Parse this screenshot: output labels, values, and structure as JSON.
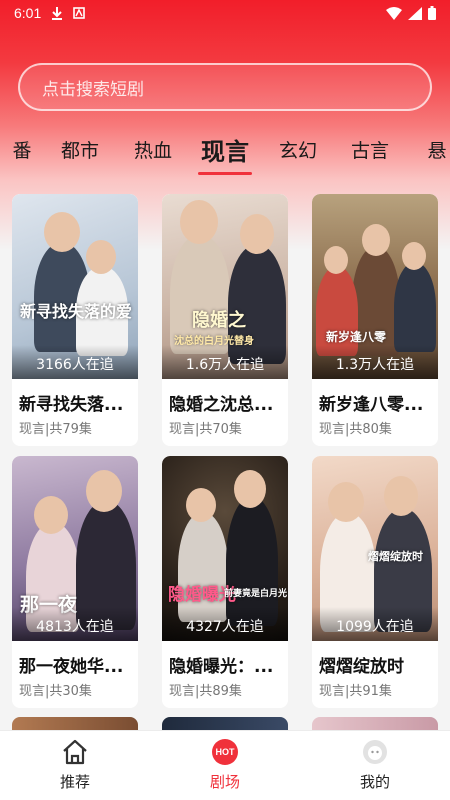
{
  "status_bar": {
    "time": "6:01"
  },
  "search": {
    "placeholder": "点击搜索短剧"
  },
  "tabs": [
    {
      "label": "番"
    },
    {
      "label": "都市"
    },
    {
      "label": "热血"
    },
    {
      "label": "现言"
    },
    {
      "label": "玄幻"
    },
    {
      "label": "古言"
    },
    {
      "label": "悬"
    }
  ],
  "active_tab": "现言",
  "dramas": [
    {
      "title": "新寻找失落...",
      "watchers": "3166人在追",
      "meta": "现言|共79集",
      "poster_text": "新寻找失落的爱"
    },
    {
      "title": "隐婚之沈总...",
      "watchers": "1.6万人在追",
      "meta": "现言|共70集",
      "poster_text": "隐婚之",
      "poster_sub": "沈总的白月光替身"
    },
    {
      "title": "新岁逢八零...",
      "watchers": "1.3万人在追",
      "meta": "现言|共80集",
      "poster_text": "新岁逢八零"
    },
    {
      "title": "那一夜她华...",
      "watchers": "4813人在追",
      "meta": "现言|共30集",
      "poster_text": "那一夜"
    },
    {
      "title": "隐婚曝光：...",
      "watchers": "4327人在追",
      "meta": "现言|共89集",
      "poster_text": "隐婚曝光",
      "poster_sub": "前妻竟是白月光"
    },
    {
      "title": "熠熠绽放时",
      "watchers": "1099人在追",
      "meta": "现言|共91集",
      "poster_text": "熠熠绽放时"
    }
  ],
  "bottom_nav": [
    {
      "label": "推荐",
      "icon": "home-icon"
    },
    {
      "label": "剧场",
      "icon": "hot-icon",
      "badge": "HOT"
    },
    {
      "label": "我的",
      "icon": "profile-icon"
    }
  ],
  "colors": {
    "accent": "#f0313b",
    "header": "#f21e2a"
  }
}
